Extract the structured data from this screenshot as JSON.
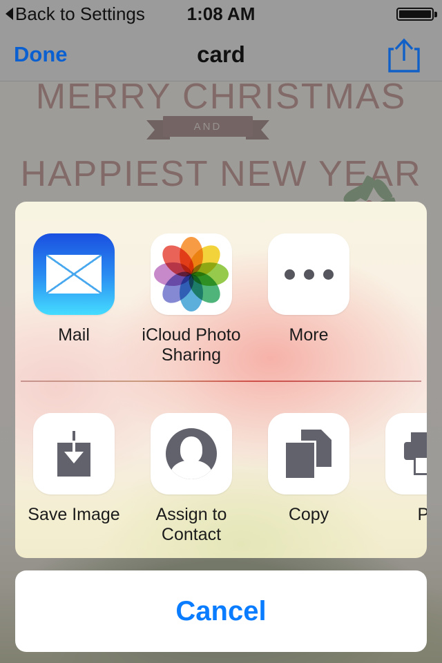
{
  "status_bar": {
    "back_label": "Back to Settings",
    "back_icon": "triangle-left-icon",
    "time": "1:08 AM",
    "battery_icon": "battery-full-icon"
  },
  "nav_bar": {
    "done_label": "Done",
    "title": "card",
    "share_icon": "share-up-arrow-icon"
  },
  "background_card": {
    "line1": "MERRY CHRISTMAS",
    "ribbon_text": "AND",
    "line2": "HAPPIEST NEW YEAR",
    "holly_icon": "holly-sprig-icon",
    "text_color": "#8d3b33",
    "ribbon_color": "#5d2723"
  },
  "share_sheet": {
    "apps": [
      {
        "label": "Mail",
        "icon": "mail-envelope-icon"
      },
      {
        "label": "iCloud Photo Sharing",
        "icon": "photos-flower-icon"
      },
      {
        "label": "More",
        "icon": "more-ellipsis-icon"
      }
    ],
    "actions": [
      {
        "label": "Save Image",
        "icon": "save-download-icon"
      },
      {
        "label": "Assign to Contact",
        "icon": "contact-person-icon"
      },
      {
        "label": "Copy",
        "icon": "copy-documents-icon"
      },
      {
        "label": "Pr",
        "icon": "printer-icon"
      }
    ],
    "divider_color": "#cf4f49"
  },
  "cancel": {
    "label": "Cancel",
    "color": "#0a7cff"
  },
  "colors": {
    "tint_blue": "#0a7cff",
    "done_blue": "#0a60d0",
    "dim_overlay": "#9b9b9b",
    "icon_gray": "#61626c"
  },
  "flower_petals": [
    "#f79434",
    "#f2d02a",
    "#8cc63e",
    "#3fae6e",
    "#4fa8d8",
    "#7b7fd0",
    "#c27fc6",
    "#e8564a"
  ]
}
